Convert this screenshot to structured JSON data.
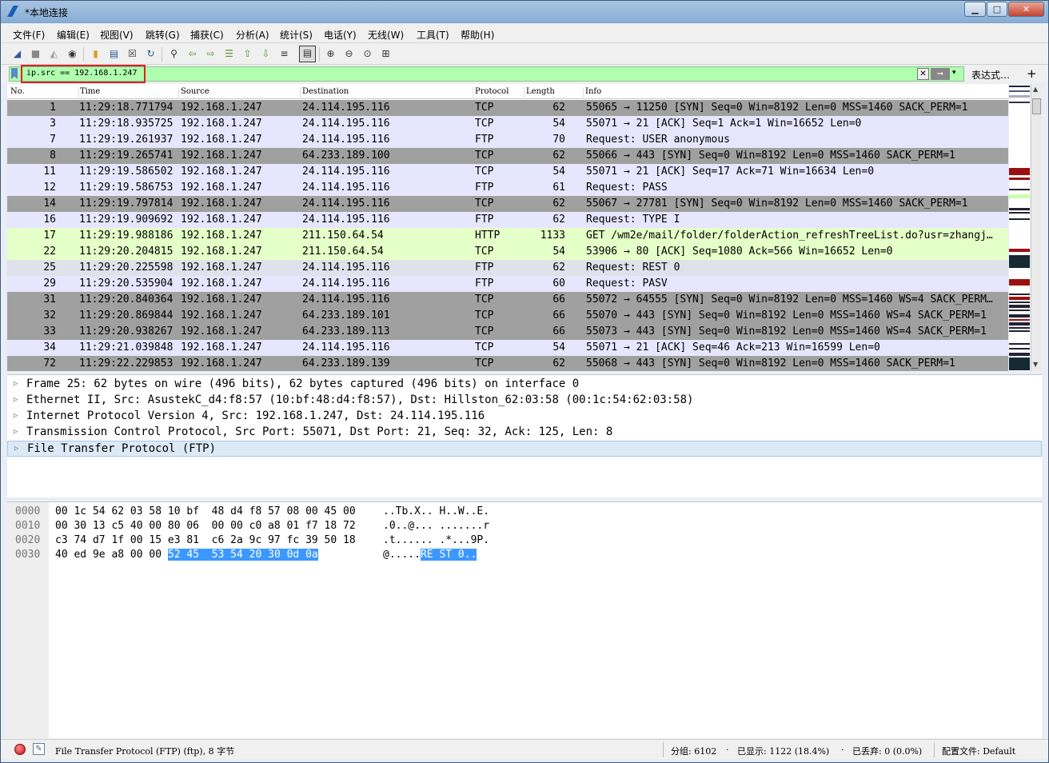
{
  "window": {
    "title": "*本地连接",
    "minimize": "▁",
    "maximize": "□",
    "close": "✕"
  },
  "menu": [
    "文件(F)",
    "编辑(E)",
    "视图(V)",
    "跳转(G)",
    "捕获(C)",
    "分析(A)",
    "统计(S)",
    "电话(Y)",
    "无线(W)",
    "工具(T)",
    "帮助(H)"
  ],
  "toolbar": [
    {
      "icon": "shark-fin-start-icon",
      "glyph": "◢"
    },
    {
      "icon": "stop-capture-icon",
      "glyph": "■"
    },
    {
      "icon": "restart-capture-icon",
      "glyph": "◭"
    },
    {
      "icon": "capture-options-icon",
      "glyph": "◉"
    },
    {
      "icon": "open-file-icon",
      "glyph": "▮"
    },
    {
      "icon": "save-file-icon",
      "glyph": "▤"
    },
    {
      "icon": "close-file-icon",
      "glyph": "☒"
    },
    {
      "icon": "reload-icon",
      "glyph": "↻"
    },
    {
      "icon": "find-packet-icon",
      "glyph": "⚲"
    },
    {
      "icon": "go-back-icon",
      "glyph": "⇦"
    },
    {
      "icon": "go-forward-icon",
      "glyph": "⇨"
    },
    {
      "icon": "go-to-packet-icon",
      "glyph": "☰"
    },
    {
      "icon": "go-first-icon",
      "glyph": "⇧"
    },
    {
      "icon": "go-last-icon",
      "glyph": "⇩"
    },
    {
      "icon": "auto-scroll-icon",
      "glyph": "≡"
    },
    {
      "icon": "colorize-icon",
      "glyph": "▤"
    },
    {
      "icon": "zoom-in-icon",
      "glyph": "⊕"
    },
    {
      "icon": "zoom-out-icon",
      "glyph": "⊖"
    },
    {
      "icon": "zoom-normal-icon",
      "glyph": "⊙"
    },
    {
      "icon": "resize-columns-icon",
      "glyph": "⊞"
    }
  ],
  "filter": {
    "value": "ip.src == 192.168.1.247",
    "expression_label": "表达式…",
    "plus": "+",
    "clear": "✕",
    "apply": "➞",
    "dropdown": "▾"
  },
  "columns": [
    "No.",
    "Time",
    "Source",
    "Destination",
    "Protocol",
    "Length",
    "Info"
  ],
  "colors": {
    "tcp_gray": "#a0a0a0",
    "tcp_light": "#e7e6ff",
    "http": "#e4ffc7",
    "selected_filter_border": "#e02020",
    "hex_highlight": "#3b98ff"
  },
  "packets": [
    {
      "no": "1",
      "time": "11:29:18.771794",
      "src": "192.168.1.247",
      "dst": "24.114.195.116",
      "proto": "TCP",
      "len": "62",
      "info": "55065 → 11250 [SYN] Seq=0 Win=8192 Len=0 MSS=1460 SACK_PERM=1",
      "bg": "#a0a0a0"
    },
    {
      "no": "3",
      "time": "11:29:18.935725",
      "src": "192.168.1.247",
      "dst": "24.114.195.116",
      "proto": "TCP",
      "len": "54",
      "info": "55071 → 21 [ACK] Seq=1 Ack=1 Win=16652 Len=0",
      "bg": "#e7e6ff"
    },
    {
      "no": "7",
      "time": "11:29:19.261937",
      "src": "192.168.1.247",
      "dst": "24.114.195.116",
      "proto": "FTP",
      "len": "70",
      "info": "Request: USER anonymous",
      "bg": "#e7e6ff"
    },
    {
      "no": "8",
      "time": "11:29:19.265741",
      "src": "192.168.1.247",
      "dst": "64.233.189.100",
      "proto": "TCP",
      "len": "62",
      "info": "55066 → 443 [SYN] Seq=0 Win=8192 Len=0 MSS=1460 SACK_PERM=1",
      "bg": "#a0a0a0"
    },
    {
      "no": "11",
      "time": "11:29:19.586502",
      "src": "192.168.1.247",
      "dst": "24.114.195.116",
      "proto": "TCP",
      "len": "54",
      "info": "55071 → 21 [ACK] Seq=17 Ack=71 Win=16634 Len=0",
      "bg": "#e7e6ff"
    },
    {
      "no": "12",
      "time": "11:29:19.586753",
      "src": "192.168.1.247",
      "dst": "24.114.195.116",
      "proto": "FTP",
      "len": "61",
      "info": "Request: PASS",
      "bg": "#e7e6ff"
    },
    {
      "no": "14",
      "time": "11:29:19.797814",
      "src": "192.168.1.247",
      "dst": "24.114.195.116",
      "proto": "TCP",
      "len": "62",
      "info": "55067 → 27781 [SYN] Seq=0 Win=8192 Len=0 MSS=1460 SACK_PERM=1",
      "bg": "#a0a0a0"
    },
    {
      "no": "16",
      "time": "11:29:19.909692",
      "src": "192.168.1.247",
      "dst": "24.114.195.116",
      "proto": "FTP",
      "len": "62",
      "info": "Request: TYPE I",
      "bg": "#e7e6ff"
    },
    {
      "no": "17",
      "time": "11:29:19.988186",
      "src": "192.168.1.247",
      "dst": "211.150.64.54",
      "proto": "HTTP",
      "len": "1133",
      "info": "GET /wm2e/mail/folder/folderAction_refreshTreeList.do?usr=zhangj…",
      "bg": "#e4ffc7"
    },
    {
      "no": "22",
      "time": "11:29:20.204815",
      "src": "192.168.1.247",
      "dst": "211.150.64.54",
      "proto": "TCP",
      "len": "54",
      "info": "53906 → 80 [ACK] Seq=1080 Ack=566 Win=16652 Len=0",
      "bg": "#e4ffc7"
    },
    {
      "no": "25",
      "time": "11:29:20.225598",
      "src": "192.168.1.247",
      "dst": "24.114.195.116",
      "proto": "FTP",
      "len": "62",
      "info": "Request: REST 0",
      "bg": "#dfe2ea"
    },
    {
      "no": "29",
      "time": "11:29:20.535904",
      "src": "192.168.1.247",
      "dst": "24.114.195.116",
      "proto": "FTP",
      "len": "60",
      "info": "Request: PASV",
      "bg": "#e7e6ff"
    },
    {
      "no": "31",
      "time": "11:29:20.840364",
      "src": "192.168.1.247",
      "dst": "24.114.195.116",
      "proto": "TCP",
      "len": "66",
      "info": "55072 → 64555 [SYN] Seq=0 Win=8192 Len=0 MSS=1460 WS=4 SACK_PERM…",
      "bg": "#a0a0a0"
    },
    {
      "no": "32",
      "time": "11:29:20.869844",
      "src": "192.168.1.247",
      "dst": "64.233.189.101",
      "proto": "TCP",
      "len": "66",
      "info": "55070 → 443 [SYN] Seq=0 Win=8192 Len=0 MSS=1460 WS=4 SACK_PERM=1",
      "bg": "#a0a0a0"
    },
    {
      "no": "33",
      "time": "11:29:20.938267",
      "src": "192.168.1.247",
      "dst": "64.233.189.113",
      "proto": "TCP",
      "len": "66",
      "info": "55073 → 443 [SYN] Seq=0 Win=8192 Len=0 MSS=1460 WS=4 SACK_PERM=1",
      "bg": "#a0a0a0"
    },
    {
      "no": "34",
      "time": "11:29:21.039848",
      "src": "192.168.1.247",
      "dst": "24.114.195.116",
      "proto": "TCP",
      "len": "54",
      "info": "55071 → 21 [ACK] Seq=46 Ack=213 Win=16599 Len=0",
      "bg": "#e7e6ff"
    },
    {
      "no": "72",
      "time": "11:29:22.229853",
      "src": "192.168.1.247",
      "dst": "64.233.189.139",
      "proto": "TCP",
      "len": "62",
      "info": "55068 → 443 [SYN] Seq=0 Win=8192 Len=0 MSS=1460 SACK_PERM=1",
      "bg": "#a0a0a0"
    }
  ],
  "details": [
    {
      "text": "Frame 25: 62 bytes on wire (496 bits), 62 bytes captured (496 bits) on interface 0",
      "selected": false
    },
    {
      "text": "Ethernet II, Src: AsustekC_d4:f8:57 (10:bf:48:d4:f8:57), Dst: Hillston_62:03:58 (00:1c:54:62:03:58)",
      "selected": false
    },
    {
      "text": "Internet Protocol Version 4, Src: 192.168.1.247, Dst: 24.114.195.116",
      "selected": false
    },
    {
      "text": "Transmission Control Protocol, Src Port: 55071, Dst Port: 21, Seq: 32, Ack: 125, Len: 8",
      "selected": false
    },
    {
      "text": "File Transfer Protocol (FTP)",
      "selected": true
    }
  ],
  "hex": [
    {
      "offset": "0000",
      "bytes": "00 1c 54 62 03 58 10 bf  48 d4 f8 57 08 00 45 00",
      "ascii": "..Tb.X.. H..W..E."
    },
    {
      "offset": "0010",
      "bytes": "00 30 13 c5 40 00 80 06  00 00 c0 a8 01 f7 18 72",
      "ascii": ".0..@... .......r"
    },
    {
      "offset": "0020",
      "bytes": "c3 74 d7 1f 00 15 e3 81  c6 2a 9c 97 fc 39 50 18",
      "ascii": ".t...... .*...9P."
    },
    {
      "offset": "0030",
      "bytes": "40 ed 9e a8 00 00 ",
      "bytes_sel": "52 45  53 54 20 30 0d 0a",
      "ascii": "@.....",
      "ascii_sel": "RE ST 0.."
    }
  ],
  "status": {
    "protocol": "File Transfer Protocol (FTP) (ftp), 8 字节",
    "groups": "分组: 6102",
    "displayed": "已显示: 1122 (18.4%)",
    "dropped": "已丢弃: 0 (0.0%)",
    "profile": "配置文件: Default",
    "dot": "·"
  }
}
